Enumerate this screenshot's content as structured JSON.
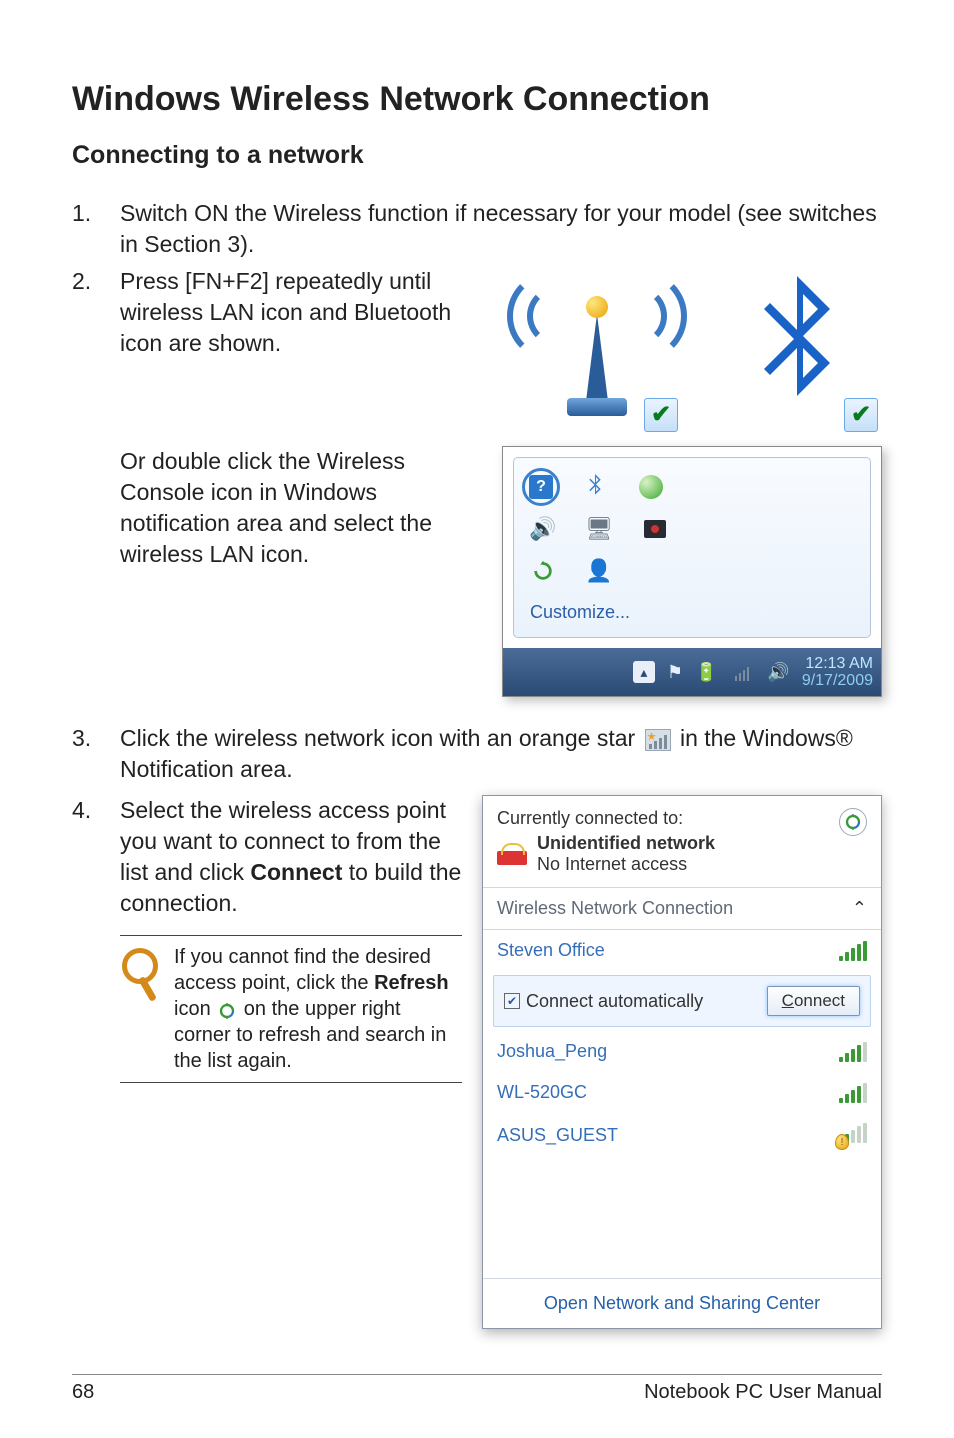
{
  "heading": "Windows Wireless Network Connection",
  "subheading": "Connecting to a network",
  "steps": {
    "s1_num": "1.",
    "s1": "Switch ON the Wireless function if necessary for your model (see switches in Section 3).",
    "s2_num": "2.",
    "s2": "Press [FN+F2] repeatedly until wireless LAN icon and Bluetooth icon are shown.",
    "s2_alt": "Or double click the Wireless Console icon in Windows notification area and select the wireless LAN icon.",
    "s3_num": "3.",
    "s3_a": "Click the wireless network icon with an orange star ",
    "s3_b": " in the Windows® Notification area.",
    "s4_num": "4.",
    "s4_a": "Select the wireless access point you want to connect to from the list and click ",
    "s4_bold": "Connect",
    "s4_b": " to build the connection."
  },
  "note": {
    "a": "If you cannot find the desired access point, click the ",
    "refresh_bold": "Refresh",
    "b": " icon ",
    "c": " on the upper right corner to refresh and search in the list again."
  },
  "tray": {
    "customize": "Customize...",
    "time": "12:13 AM",
    "date": "9/17/2009"
  },
  "wifi": {
    "currently": "Currently connected to:",
    "unidentified": "Unidentified network",
    "noaccess": "No Internet access",
    "section": "Wireless Network Connection",
    "nets": [
      "Steven Office",
      "Joshua_Peng",
      "WL-520GC",
      "ASUS_GUEST"
    ],
    "connect_auto": "Connect automatically",
    "connect_btn_pre": "C",
    "connect_btn_rest": "onnect",
    "footer": "Open Network and Sharing Center"
  },
  "footer": {
    "page": "68",
    "title": "Notebook PC User Manual"
  },
  "check_glyph": "✔",
  "caret_up": "⌃"
}
